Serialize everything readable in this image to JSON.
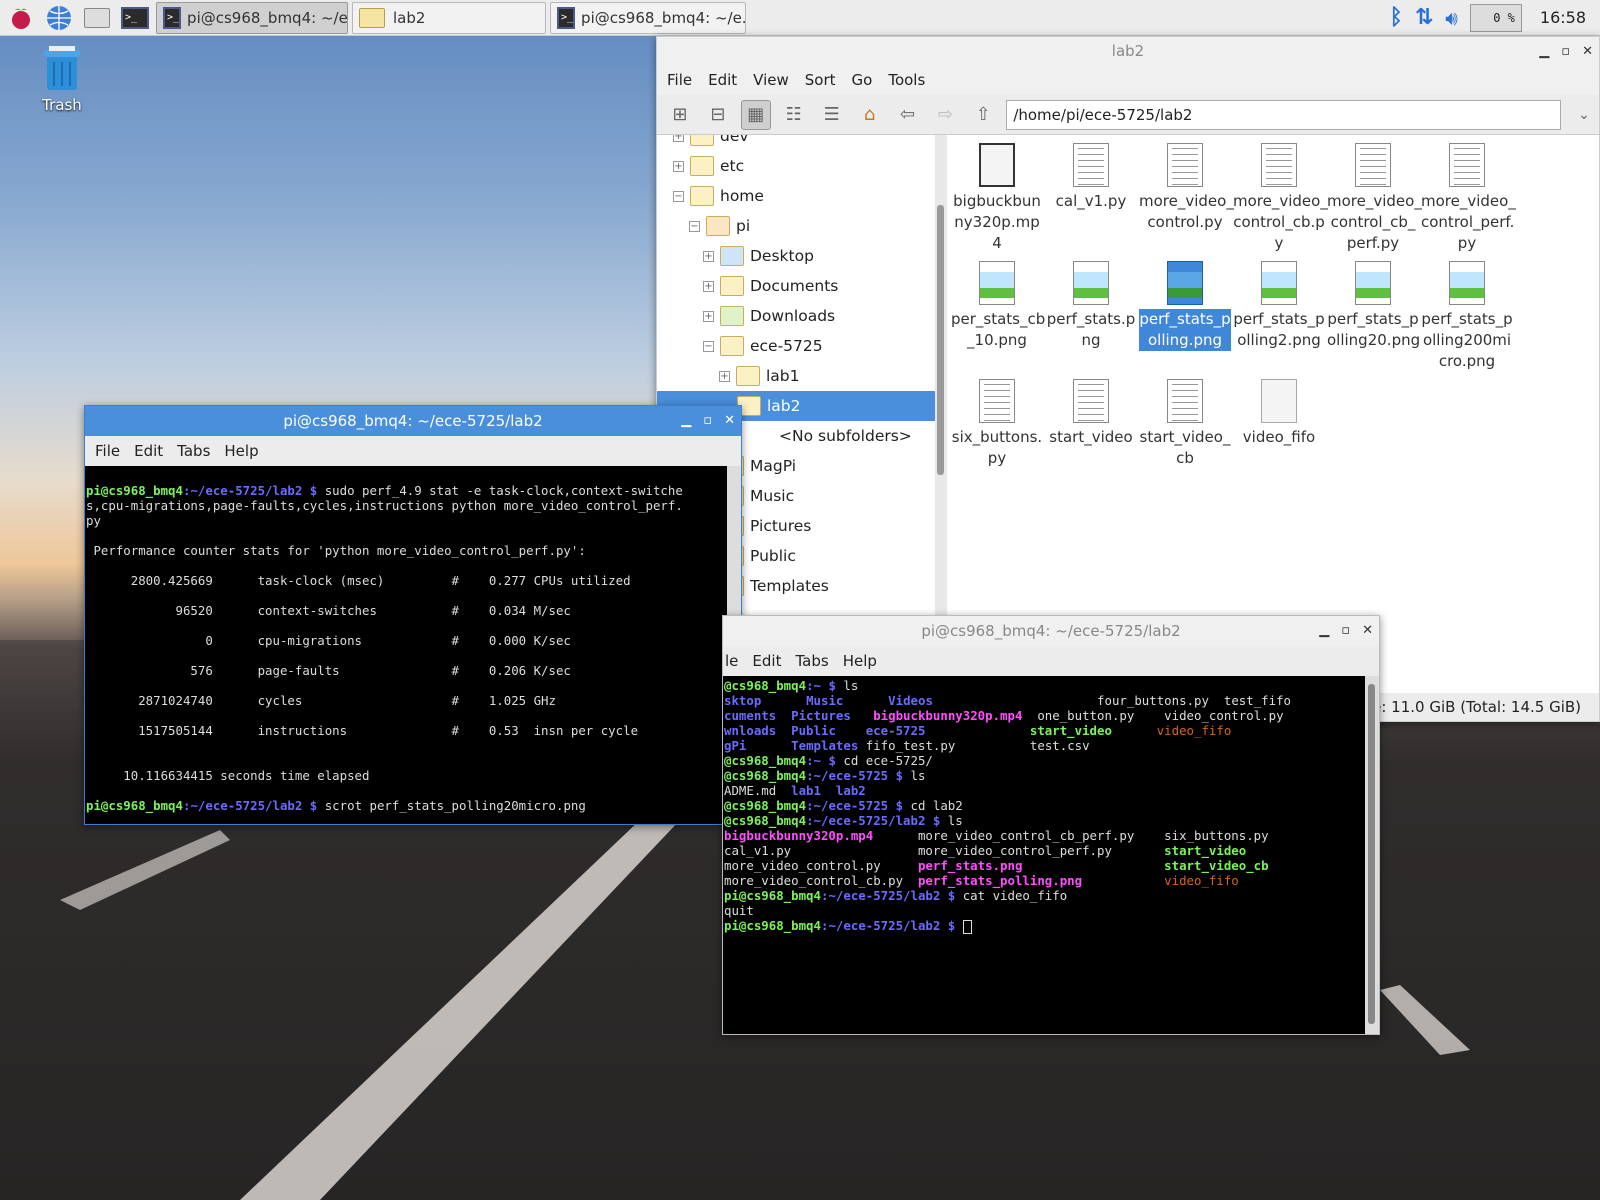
{
  "taskbar": {
    "tasks": [
      {
        "label": "pi@cs968_bmq4: ~/e..."
      },
      {
        "label": "lab2"
      },
      {
        "label": "pi@cs968_bmq4: ~/e..."
      }
    ],
    "cpu": "0 %",
    "clock": "16:58"
  },
  "desktop": {
    "trash_label": "Trash"
  },
  "file_manager": {
    "title": "lab2",
    "menu": [
      "File",
      "Edit",
      "View",
      "Sort",
      "Go",
      "Tools"
    ],
    "path": "/home/pi/ece-5725/lab2",
    "tree": [
      "dev",
      "etc",
      "home",
      "pi",
      "Desktop",
      "Documents",
      "Downloads",
      "ece-5725",
      "lab1",
      "lab2",
      "<No subfolders>",
      "MagPi",
      "Music",
      "Pictures",
      "Public",
      "Templates"
    ],
    "files": [
      {
        "name": "bigbuckbun\nny320p.mp\n4",
        "icon": "video-icon"
      },
      {
        "name": "cal_v1.py",
        "icon": "document-icon"
      },
      {
        "name": "more_video_\ncontrol.py",
        "icon": "document-icon"
      },
      {
        "name": "more_video_\ncontrol_cb.p\ny",
        "icon": "document-icon"
      },
      {
        "name": "more_video_\ncontrol_cb_\nperf.py",
        "icon": "document-icon"
      },
      {
        "name": "more_video_\ncontrol_perf.\npy",
        "icon": "document-icon"
      },
      {
        "name": "per_stats_cb\n_10.png",
        "icon": "image-icon"
      },
      {
        "name": "perf_stats.p\nng",
        "icon": "image-icon"
      },
      {
        "name": "perf_stats_p\nolling.png",
        "icon": "image-icon"
      },
      {
        "name": "perf_stats_p\nolling2.png",
        "icon": "image-icon"
      },
      {
        "name": "perf_stats_p\nolling20.png",
        "icon": "image-icon"
      },
      {
        "name": "perf_stats_p\nolling200mi\ncro.png",
        "icon": "image-icon"
      },
      {
        "name": "six_buttons.\npy",
        "icon": "document-icon"
      },
      {
        "name": "start_video",
        "icon": "document-icon"
      },
      {
        "name": "start_video_\ncb",
        "icon": "document-icon"
      },
      {
        "name": "video_fifo",
        "icon": "file-icon"
      }
    ],
    "status": "ace: 11.0 GiB (Total: 14.5 GiB)"
  },
  "terminal1": {
    "title": "pi@cs968_bmq4: ~/ece-5725/lab2",
    "menu": [
      "File",
      "Edit",
      "Tabs",
      "Help"
    ],
    "prompt_user": "pi@cs968_bmq4",
    "prompt_path": ":~/ece-5725/lab2 $",
    "cmd1": " sudo perf_4.9 stat -e task-clock,context-switche\ns,cpu-migrations,page-faults,cycles,instructions python more_video_control_perf.\npy",
    "stats_header": " Performance counter stats for 'python more_video_control_perf.py':",
    "stats": [
      "      2800.425669      task-clock (msec)         #    0.277 CPUs utilized",
      "            96520      context-switches          #    0.034 M/sec",
      "                0      cpu-migrations            #    0.000 K/sec",
      "              576      page-faults               #    0.206 K/sec",
      "       2871024740      cycles                    #    1.025 GHz",
      "       1517505144      instructions              #    0.53  insn per cycle"
    ],
    "elapsed": "     10.116634415 seconds time elapsed",
    "cmd2": " scrot perf_stats_polling20micro.png"
  },
  "terminal2": {
    "title": "pi@cs968_bmq4: ~/ece-5725/lab2",
    "menu": [
      "le",
      "Edit",
      "Tabs",
      "Help"
    ],
    "lines": {
      "l1_user": "@cs968_bmq4",
      "l1_path": ":~ $",
      "l1_cmd": " ls",
      "c1": [
        "sktop",
        "cuments",
        "wnloads",
        "gPi"
      ],
      "c2": [
        "Music",
        "Pictures",
        "Public",
        "Templates"
      ],
      "c3a": [
        "Videos"
      ],
      "c3b": "bigbuckbunny320p.mp4",
      "c3c": "ece-5725",
      "c3d": "fifo_test.py",
      "c4": [
        "four_buttons.py",
        "one_button.py",
        "start_video",
        "test.csv"
      ],
      "c5": [
        "test_fifo",
        "video_control.py",
        "video_fifo"
      ],
      "l6_path": ":~ $",
      "l6_cmd": " cd ece-5725/",
      "l7_path": ":~/ece-5725 $",
      "l7_cmd": " ls",
      "l8a": "ADME.md",
      "l8b": "lab1",
      "l8c": "lab2",
      "l9_path": ":~/ece-5725 $",
      "l9_cmd": " cd lab2",
      "l10_path": ":~/ece-5725/lab2 $",
      "l10_cmd": " ls",
      "f1": [
        "bigbuckbunny320p.mp4",
        "cal_v1.py",
        "more_video_control.py",
        "more_video_control_cb.py"
      ],
      "f2": [
        "more_video_control_cb_perf.py",
        "more_video_control_perf.py",
        "perf_stats.png",
        "perf_stats_polling.png"
      ],
      "f3": [
        "six_buttons.py",
        "start_video",
        "start_video_cb",
        "video_fifo"
      ],
      "l15_cmd": " cat video_fifo",
      "l16": "quit",
      "prompt_user_full": "pi@cs968_bmq4",
      "prompt_path_full": ":~/ece-5725/lab2 $"
    }
  }
}
